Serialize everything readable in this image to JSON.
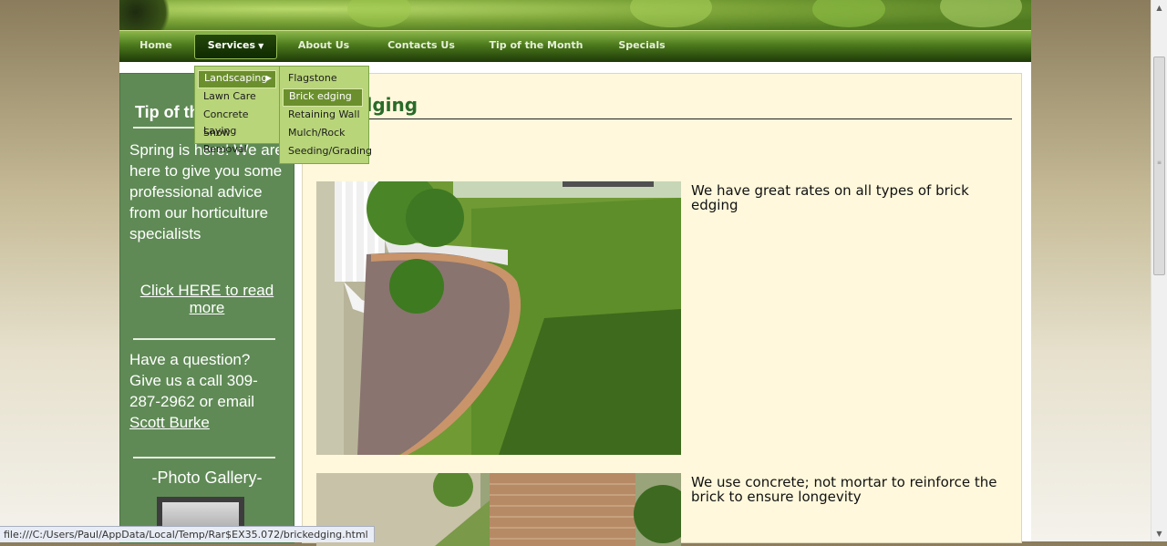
{
  "nav": {
    "items": [
      {
        "label": "Home"
      },
      {
        "label": "Services"
      },
      {
        "label": "About Us"
      },
      {
        "label": "Contacts Us"
      },
      {
        "label": "Tip of the Month"
      },
      {
        "label": "Specials"
      }
    ],
    "active": "Services"
  },
  "dropdown": {
    "primary": [
      "Landscaping",
      "Lawn Care",
      "Concrete Laying",
      "Snow Removal"
    ],
    "secondary": [
      "Flagstone",
      "Brick edging",
      "Retaining Wall",
      "Mulch/Rock",
      "Seeding/Grading"
    ],
    "highlighted_primary": "Landscaping",
    "highlighted_secondary": "Brick edging"
  },
  "sidebar": {
    "tip_title": "Tip of th",
    "tip_text": "Spring is here! We are here to give you some professional advice from our horticulture specialists",
    "read_more": "Click HERE to read more",
    "question_text": "Have a question? Give us a call 309-287-2962 or email",
    "email_name": "Scott Burke",
    "gallery_label": "-Photo Gallery-"
  },
  "content": {
    "title": "dging",
    "caption1": "We have great rates on all types of brick edging",
    "caption2": "We use concrete; not mortar to reinforce the brick to ensure longevity"
  },
  "status": {
    "url": "file:///C:/Users/Paul/AppData/Local/Temp/Rar$EX35.072/brickedging.html"
  },
  "colors": {
    "sidebar_bg": "#5f8a55",
    "content_bg": "#fff8dc",
    "title_green": "#2a6b2a",
    "menu_bg": "#b9d57a",
    "menu_highlight": "#6b8f2c"
  }
}
